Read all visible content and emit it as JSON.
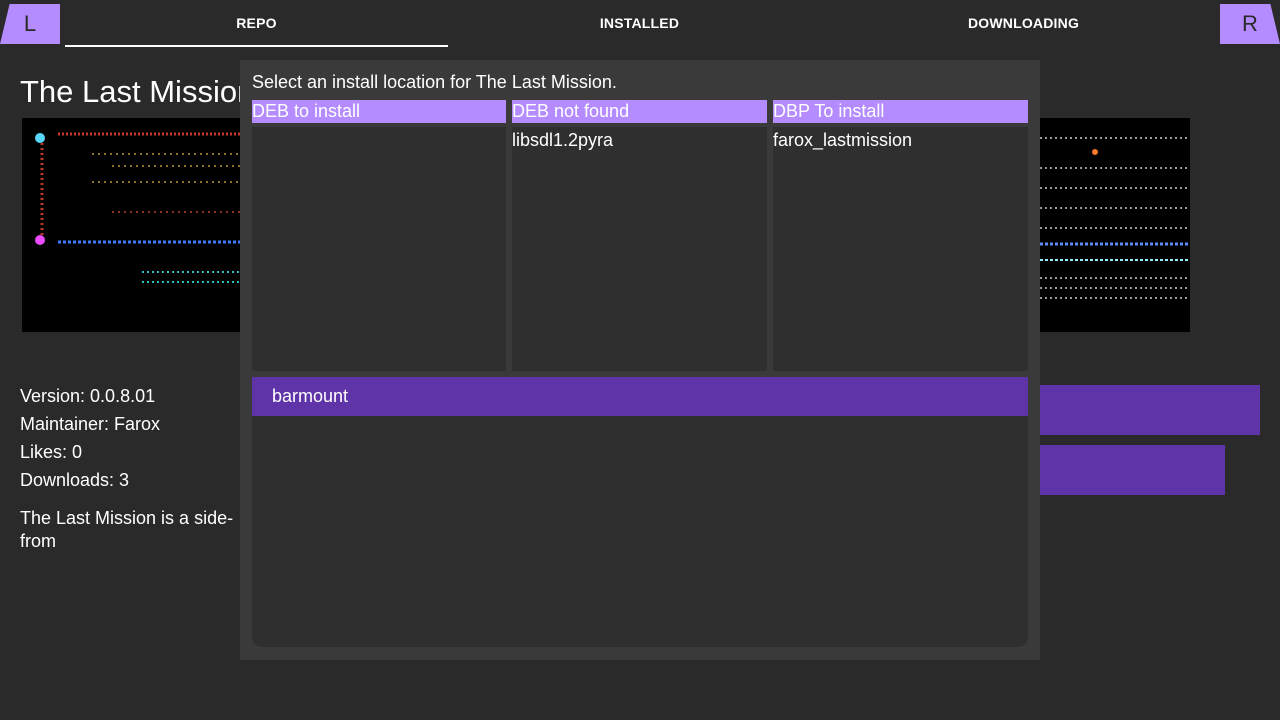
{
  "header": {
    "left_shoulder": "L",
    "right_shoulder": "R",
    "tabs": [
      {
        "label": "REPO",
        "active": true
      },
      {
        "label": "INSTALLED",
        "active": false
      },
      {
        "label": "DOWNLOADING",
        "active": false
      }
    ]
  },
  "package": {
    "title": "The Last Mission",
    "version": "Version: 0.0.8.01",
    "maintainer": "Maintainer: Farox",
    "likes": "Likes: 0",
    "downloads": "Downloads: 3",
    "description": "The Last Mission is a side-\nfrom"
  },
  "modal": {
    "title": "Select an install location for The Last Mission.",
    "columns": [
      {
        "header": "DEB to install",
        "items": []
      },
      {
        "header": "DEB not found",
        "items": [
          "libsdl1.2pyra"
        ]
      },
      {
        "header": "DBP To install",
        "items": [
          "farox_lastmission"
        ]
      }
    ],
    "locations": [
      "barmount"
    ]
  },
  "colors": {
    "background": "#2a2a2a",
    "accent": "#b48cff",
    "accent_dark": "#5e34a8",
    "modal_bg": "#3a3a3a",
    "panel_bg": "#2f2f2f"
  }
}
